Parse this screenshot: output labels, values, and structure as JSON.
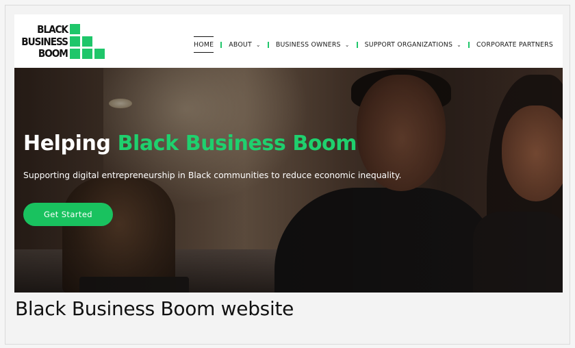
{
  "logo": {
    "line1": "BLACK",
    "line2": "BUSINESS",
    "line3": "BOOM"
  },
  "nav": {
    "items": [
      {
        "label": "HOME",
        "dropdown": false
      },
      {
        "label": "ABOUT",
        "dropdown": true
      },
      {
        "label": "BUSINESS OWNERS",
        "dropdown": true
      },
      {
        "label": "SUPPORT ORGANIZATIONS",
        "dropdown": true
      },
      {
        "label": "CORPORATE PARTNERS",
        "dropdown": false
      }
    ],
    "active": "HOME"
  },
  "hero": {
    "title_lead": "Helping",
    "title_accent": "Black Business Boom",
    "subtitle": "Supporting digital entrepreneurship in Black communities to reduce economic inequality.",
    "cta_label": "Get Started"
  },
  "caption": "Black Business Boom website",
  "colors": {
    "accent": "#1fc66a",
    "cta": "#19c25f"
  },
  "icons": {
    "dropdown": "chevron-down-icon"
  }
}
